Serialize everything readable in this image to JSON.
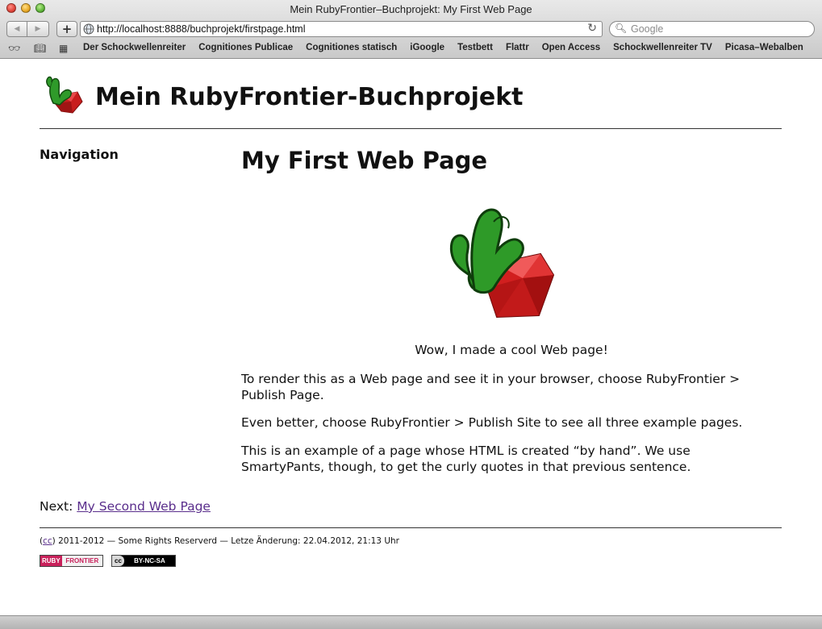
{
  "window": {
    "title": "Mein RubyFrontier–Buchprojekt: My First Web Page"
  },
  "toolbar": {
    "url": "http://localhost:8888/buchprojekt/firstpage.html",
    "search_placeholder": "Google",
    "back_icon": "back-arrow-icon",
    "forward_icon": "forward-arrow-icon"
  },
  "bookmarks": {
    "items": [
      "Der Schockwellenreiter",
      "Cognitiones Publicae",
      "Cognitiones statisch",
      "iGoogle",
      "Testbett",
      "Flattr",
      "Open Access",
      "Schockwellenreiter TV",
      "Picasa–Webalben"
    ]
  },
  "page": {
    "site_title": "Mein RubyFrontier-Buchprojekt",
    "nav_heading": "Navigation",
    "heading": "My First Web Page",
    "caption": "Wow, I made a cool Web page!",
    "para1": "To render this as a Web page and see it in your browser, choose RubyFrontier > Publish Page.",
    "para2": "Even better, choose RubyFrontier > Publish Site to see all three example pages.",
    "para3": "This is an example of a page whose HTML is created “by hand”. We use SmartyPants, though, to get the curly quotes in that previous sentence.",
    "next_label": "Next:",
    "next_link": "My Second Web Page"
  },
  "footer": {
    "cc_link": "cc",
    "text": ") 2011-2012 — Some Rights Reserverd — Letze Änderung: 22.04.2012, 21:13 Uhr",
    "badge_rf_a": "RUBY",
    "badge_rf_b": "FRONTIER",
    "badge_cc_a": "cc",
    "badge_cc_b": "BY-NC-SA"
  }
}
